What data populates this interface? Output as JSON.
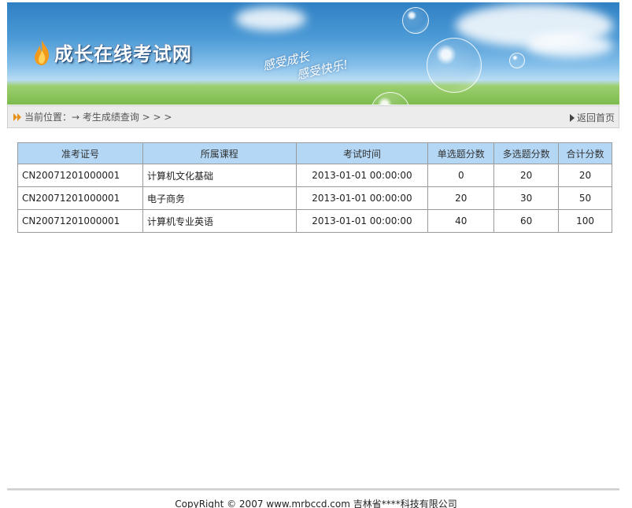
{
  "site": {
    "logo_text": "成长在线考试网",
    "slogan_line1": "感受成长",
    "slogan_line2": "感受快乐!"
  },
  "breadcrumb": {
    "text": "当前位置：→ 考生成绩查询 > > >",
    "home_link": "返回首页"
  },
  "table": {
    "headers": [
      "准考证号",
      "所属课程",
      "考试时间",
      "单选题分数",
      "多选题分数",
      "合计分数"
    ],
    "rows": [
      [
        "CN20071201000001",
        "计算机文化基础",
        "2013-01-01 00:00:00",
        "0",
        "20",
        "20"
      ],
      [
        "CN20071201000001",
        "电子商务",
        "2013-01-01 00:00:00",
        "20",
        "30",
        "50"
      ],
      [
        "CN20071201000001",
        "计算机专业英语",
        "2013-01-01 00:00:00",
        "40",
        "60",
        "100"
      ]
    ]
  },
  "footer": {
    "copyright": "CopyRight © 2007 www.mrbccd.com 吉林省****科技有限公司"
  },
  "colors": {
    "header_bg": "#b3d7f5",
    "crumb_bg": "#ececec",
    "accent_orange": "#e8911a"
  },
  "icons": {
    "logo": "flame-icon",
    "crumb": "double-arrow-right-icon",
    "home": "triangle-right-icon"
  }
}
